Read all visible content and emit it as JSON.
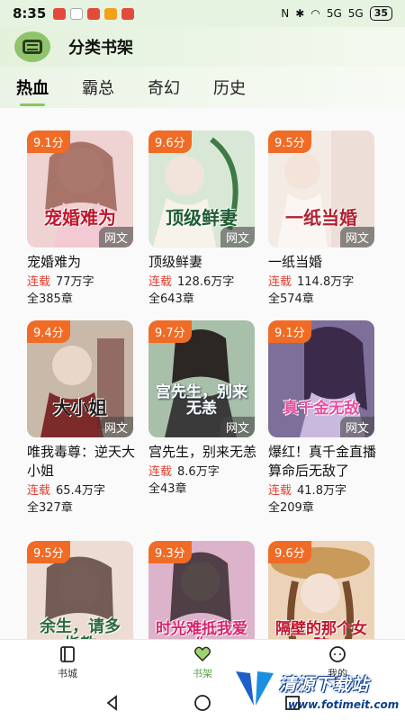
{
  "status_bar": {
    "time": "8:35",
    "battery": "35",
    "signal_1": "5G",
    "signal_2": "5G"
  },
  "header": {
    "title": "分类书架"
  },
  "tabs": [
    {
      "label": "热血",
      "active": true
    },
    {
      "label": "霸总",
      "active": false
    },
    {
      "label": "奇幻",
      "active": false
    },
    {
      "label": "历史",
      "active": false
    }
  ],
  "books": [
    {
      "score": "9.1分",
      "tag": "网文",
      "cover_text": "宠婚难为",
      "title": "宠婚难为",
      "status": "连载",
      "words": "77万字",
      "chapters": "全385章",
      "cover_color": "#e8c7c8"
    },
    {
      "score": "9.6分",
      "tag": "网文",
      "cover_text": "顶级鲜妻",
      "title": "顶级鲜妻",
      "status": "连载",
      "words": "128.6万字",
      "chapters": "全643章",
      "cover_color": "#cfe2d0"
    },
    {
      "score": "9.5分",
      "tag": "网文",
      "cover_text": "一纸当婚",
      "title": "一纸当婚",
      "status": "连载",
      "words": "114.8万字",
      "chapters": "全574章",
      "cover_color": "#f1e6df"
    },
    {
      "score": "9.4分",
      "tag": "网文",
      "cover_text": "大小姐",
      "title": "唯我毒尊：逆天大小姐",
      "status": "连载",
      "words": "65.4万字",
      "chapters": "全327章",
      "cover_color": "#c0b3a7"
    },
    {
      "score": "9.7分",
      "tag": "网文",
      "cover_text": "宫先生，别来无恙",
      "title": "宫先生，别来无恙",
      "status": "连载",
      "words": "8.6万字",
      "chapters": "全43章",
      "cover_color": "#9fb8a6"
    },
    {
      "score": "9.1分",
      "tag": "网文",
      "cover_text": "真千金无敌",
      "title": "爆红！真千金直播算命后无敌了",
      "status": "连载",
      "words": "41.8万字",
      "chapters": "全209章",
      "cover_color": "#8c7ea8"
    },
    {
      "score": "9.5分",
      "tag": "",
      "cover_text": "余生，请多指教",
      "title": "",
      "status": "",
      "words": "",
      "chapters": "",
      "cover_color": "#e9d9cf"
    },
    {
      "score": "9.3分",
      "tag": "",
      "cover_text": "时光难抵我爱你",
      "title": "",
      "status": "",
      "words": "",
      "chapters": "",
      "cover_color": "#d8a9c4"
    },
    {
      "score": "9.6分",
      "tag": "",
      "cover_text": "隔壁的那个女孩",
      "title": "",
      "status": "",
      "words": "",
      "chapters": "",
      "cover_color": "#e9cdb0"
    }
  ],
  "bottom_nav": [
    {
      "label": "书城",
      "icon": "book-city-icon",
      "active": false
    },
    {
      "label": "书架",
      "icon": "bookshelf-heart-icon",
      "active": true
    },
    {
      "label": "我的",
      "icon": "profile-chat-icon",
      "active": false
    }
  ],
  "watermark": {
    "text": "清源下载站",
    "url": "www.fotimeit.com"
  },
  "colors": {
    "accent": "#8cc462",
    "score_badge": "#f06b25",
    "serial_status": "#e13f2f"
  }
}
